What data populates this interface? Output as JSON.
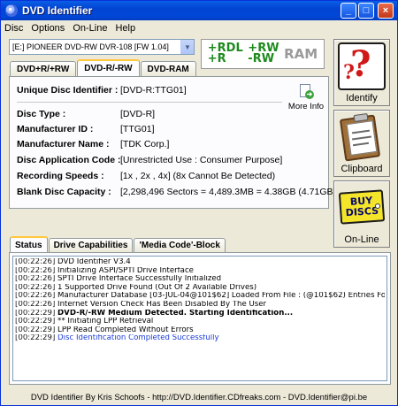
{
  "window": {
    "title": "DVD Identifier",
    "controls": {
      "minimize": "_",
      "maximize": "□",
      "close": "×"
    }
  },
  "menu": [
    "Disc",
    "Options",
    "On-Line",
    "Help"
  ],
  "drive": {
    "selected": "[E:] PIONEER  DVD-RW  DVR-108 [FW 1.04]",
    "arrow": "▼"
  },
  "logo": {
    "g1a": "+RDL",
    "g1b": "+R",
    "g2a": "+RW",
    "g2b": "-RW",
    "ram": "RAM"
  },
  "tabs": [
    "DVD+R/+RW",
    "DVD-R/-RW",
    "DVD-RAM"
  ],
  "active_tab": 1,
  "disc_info": {
    "uid_label": "Unique Disc Identifier :",
    "uid_value": "[DVD-R:TTG01]",
    "more_info": "More Info",
    "rows": [
      {
        "label": "Disc Type :",
        "value": "[DVD-R]"
      },
      {
        "label": "Manufacturer ID :",
        "value": "[TTG01]"
      },
      {
        "label": "Manufacturer Name :",
        "value": "[TDK Corp.]"
      },
      {
        "label": "Disc Application Code :",
        "value": "[Unrestricted Use : Consumer Purpose]"
      },
      {
        "label": "Recording Speeds :",
        "value": "[1x , 2x , 4x] (8x Cannot Be Detected)"
      },
      {
        "label": "Blank Disc Capacity :",
        "value": "[2,298,496 Sectors = 4,489.3MB = 4.38GB (4.71GB)]"
      }
    ]
  },
  "side_buttons": {
    "identify": "Identify",
    "identify_icon": "?",
    "clipboard": "Clipboard",
    "online": "On-Line",
    "buy_line1": "BUY",
    "buy_line2": "DISCS",
    "buy_arrow": "➜"
  },
  "log_tabs": [
    "Status",
    "Drive Capabilities",
    "'Media Code'-Block"
  ],
  "log": [
    {
      "ts": "[00:22:26]",
      "msg": "DVD Identifier V3.4",
      "style": ""
    },
    {
      "ts": "[00:22:26]",
      "msg": "Initializing ASPI/SPTI Drive Interface",
      "style": ""
    },
    {
      "ts": "[00:22:26]",
      "msg": "SPTI Drive Interface Successfully Initialized",
      "style": ""
    },
    {
      "ts": "[00:22:26]",
      "msg": "1 Supported Drive Found (Out Of 2 Available Drives)",
      "style": ""
    },
    {
      "ts": "[00:22:26]",
      "msg": "Manufacturer Database [03-JUL-04@101$62] Loaded From File : (@101$62) Entries Found",
      "style": ""
    },
    {
      "ts": "[00:22:26]",
      "msg": "Internet Version Check Has Been Disabled By The User",
      "style": ""
    },
    {
      "ts": "[00:22:29]",
      "msg": "DVD-R/-RW Medium Detected. Starting Identification...",
      "style": "bold"
    },
    {
      "ts": "[00:22:29]",
      "msg": "** Initiating LPP Retrieval",
      "style": ""
    },
    {
      "ts": "[00:22:29]",
      "msg": "LPP Read Completed Without Errors",
      "style": ""
    },
    {
      "ts": "[00:22:29]",
      "msg": "Disc Identification Completed Successfully",
      "style": "blue"
    }
  ],
  "status_bar": "DVD Identifier By Kris Schoofs  -  http://DVD.Identifier.CDfreaks.com  -  DVD.Identifier@pi.be"
}
